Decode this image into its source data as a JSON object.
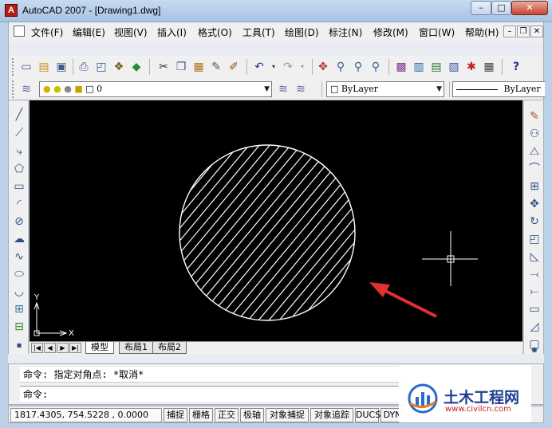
{
  "window": {
    "title": "AutoCAD 2007 - [Drawing1.dwg]",
    "app_icon_letter": "A",
    "minimize": "–",
    "maximize": "□",
    "close": "✕"
  },
  "menu": {
    "items": [
      "文件(F)",
      "编辑(E)",
      "视图(V)",
      "插入(I)",
      "格式(O)",
      "工具(T)",
      "绘图(D)",
      "标注(N)",
      "修改(M)",
      "窗口(W)",
      "帮助(H)"
    ],
    "doc_minimize": "–",
    "doc_restore": "❐",
    "doc_close": "✕"
  },
  "layer_toolbar": {
    "layer_value": "0",
    "color_value": "ByLayer",
    "linetype_value": "ByLayer"
  },
  "layout_tabs": [
    "模型",
    "布局1",
    "布局2"
  ],
  "ucs": {
    "y_label": "Y",
    "x_label": "X"
  },
  "command": {
    "history": "命令: 指定对角点: *取消*",
    "prompt": "命令:"
  },
  "status": {
    "coordinates": "1817.4305, 754.5228 , 0.0000",
    "buttons": [
      "捕捉",
      "栅格",
      "正交",
      "极轴",
      "对象捕捉",
      "对象追踪",
      "DUCS",
      "DYN"
    ]
  },
  "watermark": {
    "title": "土木工程网",
    "url": "www.civilcn.com"
  },
  "colors": {
    "canvas": "#000000",
    "hatch": "#ffffff",
    "arrow": "#e03030",
    "title_accent": "#1f3e8f"
  },
  "icons": {
    "standard_toolbar": [
      "new-icon",
      "open-icon",
      "save-icon",
      "print-icon",
      "preview-icon",
      "publish-icon",
      "plot-3d-icon",
      "cut-icon",
      "copy-icon",
      "paste-icon",
      "match-prop-icon",
      "block-editor-icon",
      "undo-icon",
      "redo-icon",
      "pan-icon",
      "zoom-realtime-icon",
      "zoom-window-icon",
      "zoom-previous-icon",
      "properties-icon",
      "design-center-icon",
      "tool-palettes-icon",
      "sheet-set-icon",
      "markup-icon",
      "calculator-icon",
      "help-icon"
    ],
    "draw_toolbar": [
      "line-icon",
      "construction-line-icon",
      "polyline-icon",
      "polygon-icon",
      "rectangle-icon",
      "arc-icon",
      "circle-icon",
      "revision-cloud-icon",
      "spline-icon",
      "ellipse-icon",
      "ellipse-arc-icon",
      "insert-block-icon",
      "make-block-icon",
      "point-icon"
    ],
    "modify_toolbar": [
      "erase-icon",
      "copy-object-icon",
      "mirror-icon",
      "offset-icon",
      "array-icon",
      "move-icon",
      "rotate-icon",
      "scale-icon",
      "stretch-icon",
      "trim-icon",
      "extend-icon",
      "break-icon",
      "join-icon",
      "chamfer-icon",
      "explode-icon"
    ]
  }
}
